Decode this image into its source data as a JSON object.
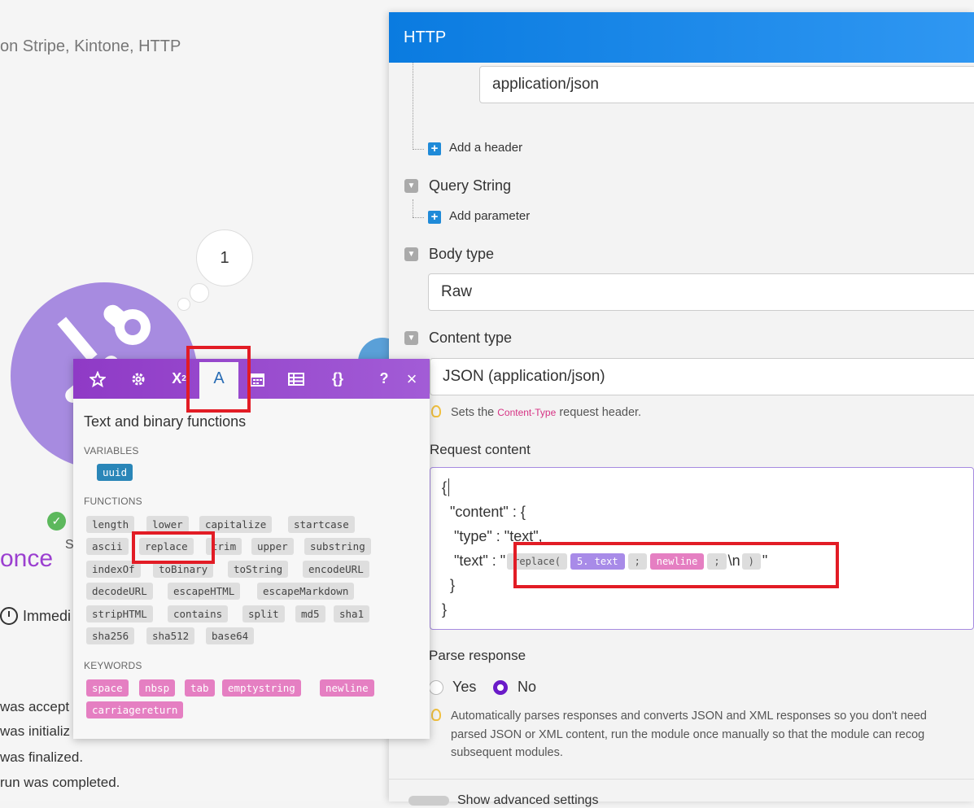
{
  "background": {
    "subtitle": "on Stripe, Kintone, HTTP",
    "bubble_count": "1",
    "status_letter": "S",
    "scenario_label": "once",
    "schedule_label": "Immedi",
    "log_lines": [
      "was accept",
      "was initializ",
      "was finalized.",
      "run was completed."
    ]
  },
  "panel": {
    "title": "HTTP",
    "header_value": "application/json",
    "add_header_label": "Add a header",
    "query_string_label": "Query String",
    "add_parameter_label": "Add parameter",
    "body_type_label": "Body type",
    "body_type_value": "Raw",
    "content_type_label": "Content type",
    "content_type_value": "JSON (application/json)",
    "content_type_hint_prefix": "Sets the",
    "content_type_hint_code": "Content-Type",
    "content_type_hint_suffix": "request header.",
    "request_content_label": "Request content",
    "code": {
      "line1": "{",
      "line2": "  \"content\" : {",
      "line3": "   \"type\" : \"text\",",
      "line4_prefix": "   \"text\" : \"",
      "fn_replace": "replace(",
      "var_text": "5. text",
      "sep1": ";",
      "kw_newline": "newline",
      "sep2": ";",
      "literal": "\\n",
      "close_paren": ")",
      "line4_suffix": "\"",
      "line5": "  }",
      "line6": "}"
    },
    "parse_response_label": "Parse response",
    "parse_yes": "Yes",
    "parse_no": "No",
    "parse_selected": "No",
    "parse_hint_lines": [
      "Automatically parses responses and converts JSON and XML responses so you don't need",
      "parsed JSON or XML content, run the module once manually so that the module can recog",
      "subsequent modules."
    ],
    "advanced_label": "Show advanced settings"
  },
  "popup": {
    "tabs": [
      "star-icon",
      "gear-icon",
      "math-icon",
      "text-icon",
      "calendar-icon",
      "table-icon",
      "braces-icon"
    ],
    "tab_math_label": "X",
    "tab_text_label": "A",
    "tab_braces_label": "{}",
    "help_label": "?",
    "close_label": "×",
    "title": "Text and binary functions",
    "variables_label": "VARIABLES",
    "variables": [
      "uuid"
    ],
    "functions_label": "FUNCTIONS",
    "functions": [
      "length",
      "lower",
      "capitalize",
      "startcase",
      "ascii",
      "replace",
      "trim",
      "upper",
      "substring",
      "indexOf",
      "toBinary",
      "toString",
      "encodeURL",
      "decodeURL",
      "escapeHTML",
      "escapeMarkdown",
      "stripHTML",
      "contains",
      "split",
      "md5",
      "sha1",
      "sha256",
      "sha512",
      "base64"
    ],
    "keywords_label": "KEYWORDS",
    "keywords": [
      "space",
      "nbsp",
      "tab",
      "emptystring",
      "newline",
      "carriagereturn"
    ]
  },
  "colors": {
    "header_blue": "#0a7be0",
    "popup_purple": "#8f3ac6",
    "highlight_red": "#e21c25",
    "keyword_pink": "#e57fc2",
    "variable_purple": "#a88be8"
  }
}
